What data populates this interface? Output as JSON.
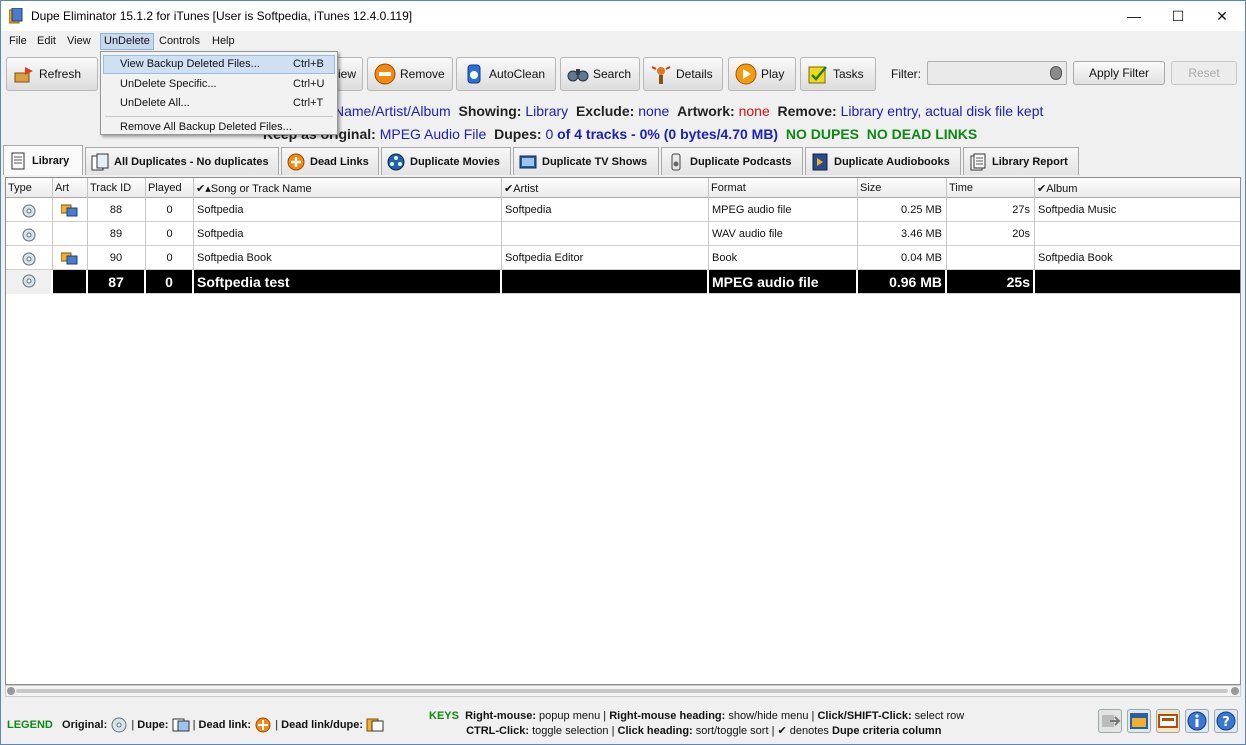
{
  "window": {
    "title": "Dupe Eliminator 15.1.2 for iTunes  [User is Softpedia, iTunes 12.4.0.119]",
    "controls": {
      "minimize": "—",
      "maximize": "☐",
      "close": "✕"
    }
  },
  "menubar": {
    "file": "File",
    "edit": "Edit",
    "view": "View",
    "undelete": "UnDelete",
    "controls": "Controls",
    "help": "Help"
  },
  "undelete_menu": {
    "view_backup": {
      "label": "View Backup Deleted Files...",
      "shortcut": "Ctrl+B"
    },
    "undelete_specific": {
      "label": "UnDelete Specific...",
      "shortcut": "Ctrl+U"
    },
    "undelete_all": {
      "label": "UnDelete All...",
      "shortcut": "Ctrl+T"
    },
    "remove_all": {
      "label": "Remove All Backup Deleted Files..."
    }
  },
  "toolbar": {
    "refresh": "Refresh",
    "view_partial": "iew",
    "remove": "Remove",
    "autoclean": "AutoClean",
    "search": "Search",
    "details": "Details",
    "play": "Play",
    "tasks": "Tasks",
    "filter_label": "Filter:",
    "filter_value": "",
    "apply_filter": "Apply Filter",
    "reset": "Reset"
  },
  "status": {
    "match_value_partial": "Name/Artist/Album",
    "showing_label": "Showing:",
    "showing_value": "Library",
    "exclude_label": "Exclude:",
    "exclude_value": "none",
    "artwork_label": "Artwork:",
    "artwork_value": "none",
    "remove_label": "Remove:",
    "remove_value": "Library entry, actual disk file kept",
    "keep_label_partial": "Keep as original:",
    "keep_value": "MPEG Audio File",
    "dupes_label": "Dupes:",
    "dupes_count": "0",
    "dupes_summary": "of 4 tracks - 0% (0 bytes/4.70 MB)",
    "no_dupes": "NO DUPES",
    "no_dead_links": "NO DEAD LINKS"
  },
  "tabs": {
    "library": "Library",
    "all_duplicates": "All Duplicates - No duplicates",
    "dead_links": "Dead Links",
    "duplicate_movies": "Duplicate Movies",
    "duplicate_tv_shows": "Duplicate TV Shows",
    "duplicate_podcasts": "Duplicate Podcasts",
    "duplicate_audiobooks": "Duplicate Audiobooks",
    "library_report": "Library Report"
  },
  "table": {
    "columns": {
      "type": "Type",
      "art": "Art",
      "track_id": "Track ID",
      "played": "Played",
      "song": "✔▴Song or Track Name",
      "artist": "✔Artist",
      "format": "Format",
      "size": "Size",
      "time": "Time",
      "album": "✔Album"
    },
    "rows": [
      {
        "track_id": "88",
        "played": "0",
        "song": "Softpedia",
        "artist": "Softpedia",
        "format": "MPEG audio file",
        "size": "0.25 MB",
        "time": "27s",
        "album": "Softpedia Music",
        "has_art": true
      },
      {
        "track_id": "89",
        "played": "0",
        "song": "Softpedia",
        "artist": "",
        "format": "WAV audio file",
        "size": "3.46 MB",
        "time": "20s",
        "album": "",
        "has_art": false
      },
      {
        "track_id": "90",
        "played": "0",
        "song": "Softpedia Book",
        "artist": "Softpedia Editor",
        "format": "Book",
        "size": "0.04 MB",
        "time": "",
        "album": "Softpedia Book",
        "has_art": true
      },
      {
        "track_id": "87",
        "played": "0",
        "song": "Softpedia test",
        "artist": "",
        "format": "MPEG audio file",
        "size": "0.96 MB",
        "time": "25s",
        "album": "",
        "has_art": false
      }
    ]
  },
  "legend": {
    "title": "LEGEND",
    "original": "Original:",
    "dupe": "Dupe:",
    "dead_link": "Dead link:",
    "dead_link_dupe": "Dead link/dupe:",
    "sep": "|"
  },
  "keys": {
    "title": "KEYS",
    "right_mouse": "Right-mouse:",
    "right_mouse_desc": "popup menu",
    "right_mouse_heading": "Right-mouse heading:",
    "right_mouse_heading_desc": "show/hide menu",
    "click_shift": "Click/SHIFT-Click:",
    "click_shift_desc": "select row",
    "ctrl_click": "CTRL-Click:",
    "ctrl_click_desc": "toggle selection",
    "click_heading": "Click heading:",
    "click_heading_desc": "sort/toggle sort",
    "denotes": "✔ denotes",
    "dupe_criteria": "Dupe criteria column",
    "sep": "|"
  },
  "colors": {
    "accent_blue": "#1b22b8",
    "accent_red": "#d91010",
    "accent_green": "#0c8a14",
    "selected_row": "#000000",
    "menu_highlight": "#cfe0f3"
  }
}
